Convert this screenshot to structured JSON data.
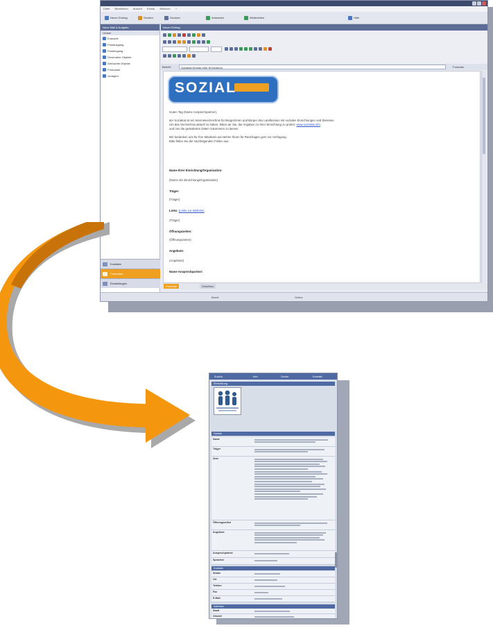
{
  "window": {
    "title": "",
    "menu": [
      "Datei",
      "Bearbeiten",
      "Ansicht",
      "Extras",
      "Aktionen",
      "?"
    ],
    "toolbar": [
      "Neuer Eintrag",
      "Senden",
      "Drucken",
      "Antworten",
      "Weiterleiten",
      "Hilfe"
    ]
  },
  "left_pane": {
    "header": "Neue Mail & Aufgabe",
    "subheader": "Ordner",
    "items": [
      "Entwürfe",
      "Postausgang",
      "Posteingang",
      "Gesendete Objekte",
      "Gelöschte Objekte",
      "Formulare",
      "Vorlagen"
    ],
    "bottom": [
      "Kontakte",
      "Formulare",
      "Einstellungen"
    ]
  },
  "editor": {
    "header": "Neuer Eintrag",
    "subject_label": "Betreff:",
    "subject_value": "Sozialrat Eintrag Ihrer Einrichtung",
    "prefill_button": "Formular",
    "tabs": [
      "Formular",
      "Vorschau"
    ]
  },
  "document": {
    "logo_text": "SOZIAL",
    "logo_subtext": "",
    "greeting": "Guten Tag (Name Ansprechpartner),",
    "para1_line1": "der Sozialrat ist ein Internetverzeichnis für Bürgerinnen und Bürger des Landkreises mit sozialen Einrichtungen und Diensten.",
    "para1_line2": "Um das Verzeichnis aktuell zu halten, bitten wir Sie, die Angaben zu Ihrer Einrichtung zu prüfen:",
    "para1_link": "www.sozialrat.info",
    "para1_line3": "und uns die geänderten Daten zukommen zu lassen.",
    "para2_line1": "Wir bedanken uns für Ihre Mitarbeit und stehen Ihnen für Rückfragen gern zur Verfügung.",
    "para2_line2": "Bitte füllen Sie die nachfolgenden Felder aus.",
    "fields": [
      {
        "label": "Name Ihrer Einrichtung/Organisation:",
        "value": "(Name der Einrichtung/Organisation)"
      },
      {
        "label": "Träger:",
        "value": "(Träger)"
      },
      {
        "label": "Links:",
        "value": "(Links zur Website)"
      },
      {
        "label": "Öffnungszeiten:",
        "value": "(Öffnungszeiten)"
      },
      {
        "label": "Angebote:",
        "value": "(Angebote)"
      },
      {
        "label": "Name Ansprechpartner:",
        "value": ""
      }
    ]
  },
  "status": {
    "left": "Bereit",
    "right": "Online"
  },
  "phone": {
    "tabs": [
      "Zurück",
      "Info",
      "Suche",
      "Kontakt"
    ],
    "section1": "Einrichtung",
    "section2": "Details",
    "section3": "Kontakt",
    "section4": "Adresse",
    "rows": [
      "Name",
      "Träger",
      "Ziele",
      "Öffnungszeiten",
      "Angebote",
      "Ansprechpartner",
      "Sprachen"
    ],
    "contact_rows": [
      "Straße",
      "Ort",
      "Telefon",
      "Fax",
      "E-Mail"
    ],
    "address_rows": [
      "Stadt",
      "Ortsteil"
    ]
  },
  "colors": {
    "accent": "#4f6aa3",
    "arrow": "#f5960f",
    "logo": "#2f6fbf"
  }
}
